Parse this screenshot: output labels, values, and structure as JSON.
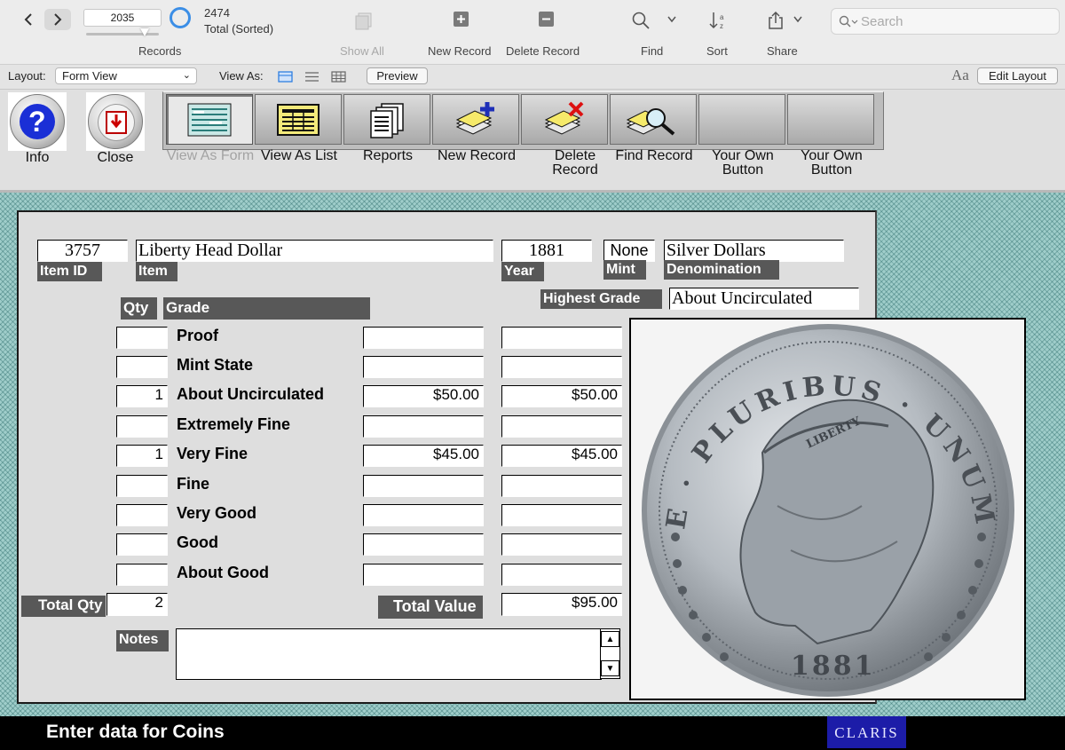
{
  "toolbar": {
    "record_current": "2035",
    "record_count": "2474",
    "record_status": "Total (Sorted)",
    "records_label": "Records",
    "show_all_label": "Show All",
    "new_record_label": "New Record",
    "delete_record_label": "Delete Record",
    "find_label": "Find",
    "sort_label": "Sort",
    "share_label": "Share",
    "search_placeholder": "Search"
  },
  "layout_bar": {
    "layout_label": "Layout:",
    "layout_value": "Form View",
    "view_as_label": "View As:",
    "preview_label": "Preview",
    "font_size_glyph": "Aa",
    "edit_layout_label": "Edit Layout"
  },
  "button_band": {
    "info_label": "Info",
    "close_label": "Close",
    "buttons": [
      {
        "label": "View As Form"
      },
      {
        "label": "View As List"
      },
      {
        "label": "Reports"
      },
      {
        "label": "New Record"
      },
      {
        "label": "Delete Record"
      },
      {
        "label": "Find Record"
      },
      {
        "label": "Your Own Button"
      },
      {
        "label": "Your Own Button"
      }
    ]
  },
  "form": {
    "item_id_value": "3757",
    "item_id_label": "Item ID",
    "item_value": "Liberty Head Dollar",
    "item_label": "Item",
    "year_value": "1881",
    "year_label": "Year",
    "mint_value": "None",
    "mint_label": "Mint",
    "denomination_value": "Silver Dollars",
    "denomination_label": "Denomination",
    "highest_grade_label": "Highest Grade",
    "highest_grade_value": "About Uncirculated",
    "qty_header": "Qty",
    "grade_header": "Grade",
    "grades": [
      {
        "qty": "",
        "name": "Proof",
        "price": "",
        "value": ""
      },
      {
        "qty": "",
        "name": "Mint State",
        "price": "",
        "value": ""
      },
      {
        "qty": "1",
        "name": "About Uncirculated",
        "price": "$50.00",
        "value": "$50.00"
      },
      {
        "qty": "",
        "name": "Extremely Fine",
        "price": "",
        "value": ""
      },
      {
        "qty": "1",
        "name": "Very Fine",
        "price": "$45.00",
        "value": "$45.00"
      },
      {
        "qty": "",
        "name": "Fine",
        "price": "",
        "value": ""
      },
      {
        "qty": "",
        "name": "Very Good",
        "price": "",
        "value": ""
      },
      {
        "qty": "",
        "name": "Good",
        "price": "",
        "value": ""
      },
      {
        "qty": "",
        "name": "About Good",
        "price": "",
        "value": ""
      }
    ],
    "total_qty_label": "Total Qty",
    "total_qty_value": "2",
    "total_value_label": "Total Value",
    "total_value_value": "$95.00",
    "notes_label": "Notes",
    "notes_value": ""
  },
  "coin": {
    "legend": "E · PLURIBUS · UNUM",
    "cap_text": "LIBERTY",
    "date": "1881"
  },
  "status_bar": {
    "message": "Enter data for Coins",
    "brand": "CLARIS"
  }
}
